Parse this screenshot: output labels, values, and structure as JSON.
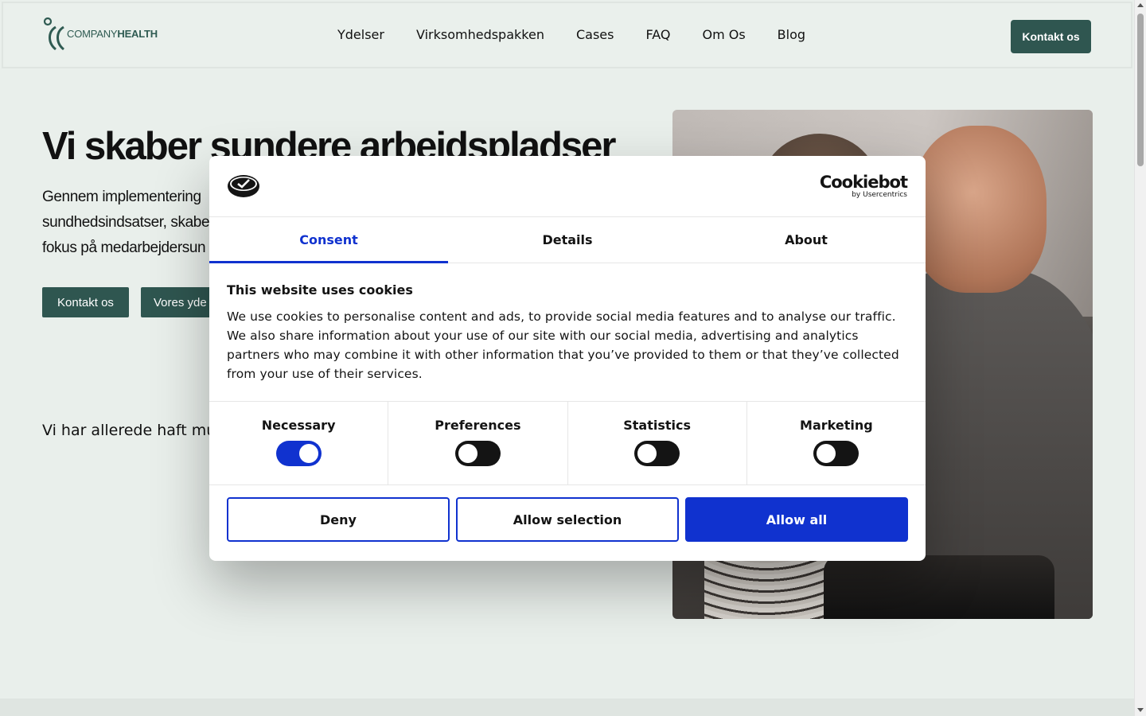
{
  "site": {
    "logo_text_light": "COMPANY",
    "logo_text_bold": "HEALTH",
    "nav": [
      "Ydelser",
      "Virksomhedspakken",
      "Cases",
      "FAQ",
      "Om Os",
      "Blog"
    ],
    "header_cta": "Kontakt os"
  },
  "hero": {
    "title": "Vi skaber sundere arbejdspladser",
    "desc_line1": "Gennem implementering",
    "desc_line2": "sundhedsindsatser, skabe",
    "desc_line3": "fokus på medarbejdersun",
    "btn_contact": "Kontakt os",
    "btn_services": "Vores yde",
    "trusted": "Vi har allerede haft mu"
  },
  "cookie": {
    "brand": "Cookiebot",
    "brand_sub": "by Usercentrics",
    "tabs": [
      "Consent",
      "Details",
      "About"
    ],
    "title": "This website uses cookies",
    "text": "We use cookies to personalise content and ads, to provide social media features and to analyse our traffic. We also share information about your use of our site with our social media, advertising and analytics partners who may combine it with other information that you’ve provided to them or that they’ve collected from your use of their services.",
    "categories": [
      {
        "label": "Necessary",
        "on": true
      },
      {
        "label": "Preferences",
        "on": false
      },
      {
        "label": "Statistics",
        "on": false
      },
      {
        "label": "Marketing",
        "on": false
      }
    ],
    "deny": "Deny",
    "allow_selection": "Allow selection",
    "allow_all": "Allow all",
    "accent": "#1032cf"
  },
  "colors": {
    "brand_green": "#2f5650",
    "page_bg": "#e9efeb"
  }
}
